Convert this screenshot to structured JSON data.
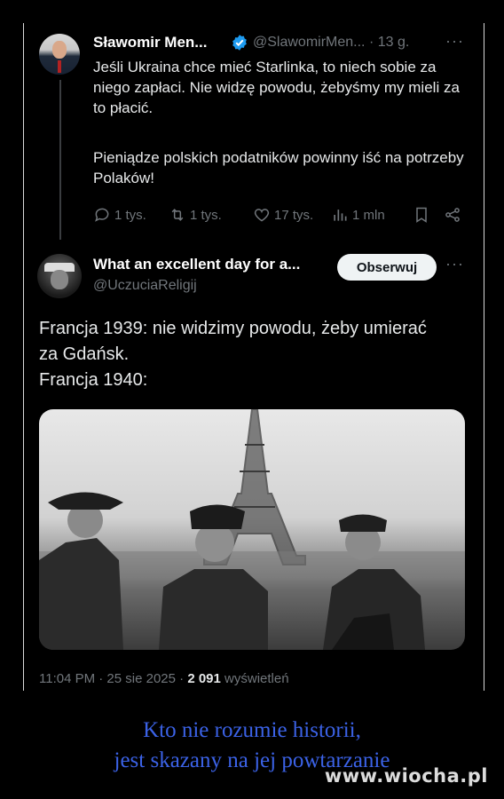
{
  "tweet1": {
    "author_name": "Sławomir Men...",
    "handle_time": "@SlawomirMen... · 13 g.",
    "text_p1": "Jeśli Ukraina chce mieć Starlinka, to niech sobie za niego zapłaci. Nie widzę powodu, żebyśmy my mieli za to płacić.",
    "text_p2": "Pieniądze polskich podatników powinny iść na potrzeby Polaków!",
    "replies": "1 tys.",
    "retweets": "1 tys.",
    "likes": "17 tys.",
    "views": "1 mln",
    "verified_color": "#1d9bf0"
  },
  "tweet2": {
    "author_name": "What an excellent day for a...",
    "handle": "@UczuciaReligij",
    "follow_label": "Obserwuj",
    "text_l1": "Francja 1939: nie widzimy powodu, żeby umierać",
    "text_l2": "za Gdańsk.",
    "text_l3": "Francja 1940:",
    "timestamp": "11:04 PM · 25 sie 2025 · ",
    "views_count": "2 091",
    "views_label": " wyświetleń"
  },
  "caption": {
    "line1": "Kto nie rozumie historii,",
    "line2": "jest skazany na jej powtarzanie",
    "color": "#3b62e6"
  },
  "watermark": "www.wiocha.pl"
}
